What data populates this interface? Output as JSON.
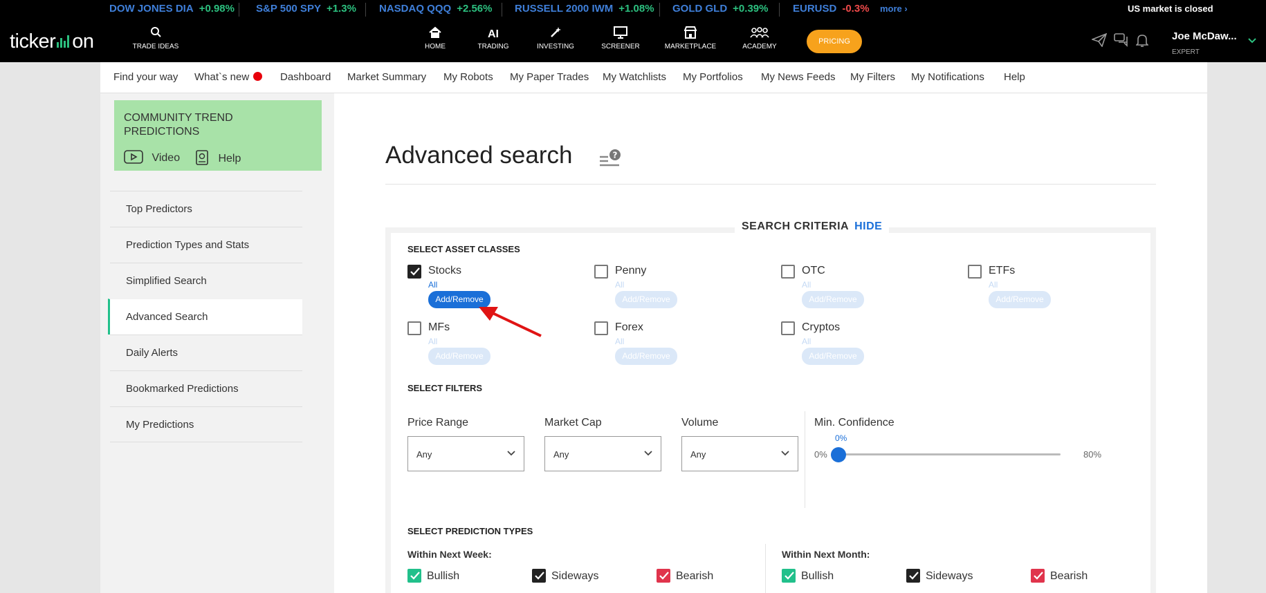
{
  "ticker": {
    "items": [
      {
        "name": "DOW JONES DIA",
        "change": "+0.98%",
        "dir": "pos"
      },
      {
        "name": "S&P 500 SPY",
        "change": "+1.3%",
        "dir": "pos"
      },
      {
        "name": "NASDAQ QQQ",
        "change": "+2.56%",
        "dir": "pos"
      },
      {
        "name": "RUSSELL 2000 IWM",
        "change": "+1.08%",
        "dir": "pos"
      },
      {
        "name": "GOLD GLD",
        "change": "+0.39%",
        "dir": "pos"
      },
      {
        "name": "EURUSD",
        "change": "-0.3%",
        "dir": "neg"
      }
    ],
    "more": "more ›",
    "market_status": "US market is closed"
  },
  "nav": {
    "logo_left": "ticker",
    "logo_right": "on",
    "trade_ideas": "TRADE IDEAS",
    "items": [
      {
        "label": "HOME",
        "icon": "home-icon"
      },
      {
        "label": "TRADING",
        "icon": "ai-text"
      },
      {
        "label": "INVESTING",
        "icon": "wand-icon"
      },
      {
        "label": "SCREENER",
        "icon": "monitor-icon"
      },
      {
        "label": "MARKETPLACE",
        "icon": "store-icon"
      },
      {
        "label": "ACADEMY",
        "icon": "people-icon"
      }
    ],
    "ai_text": "AI",
    "pricing": "PRICING",
    "user_name": "Joe McDaw...",
    "user_role": "EXPERT"
  },
  "subnav": {
    "items": [
      "Find your way",
      "What`s new",
      "Dashboard",
      "Market Summary",
      "My Robots",
      "My Paper Trades",
      "My Watchlists",
      "My Portfolios",
      "My News Feeds",
      "My Filters",
      "My Notifications",
      "Help"
    ]
  },
  "sidebar": {
    "promo_title_1": "COMMUNITY TREND",
    "promo_title_2": "PREDICTIONS",
    "video": "Video",
    "help": "Help",
    "items": [
      "Top Predictors",
      "Prediction Types and Stats",
      "Simplified Search",
      "Advanced Search",
      "Daily Alerts",
      "Bookmarked Predictions",
      "My Predictions"
    ],
    "active_index": 3
  },
  "main": {
    "title": "Advanced search",
    "criteria_title": "SEARCH CRITERIA",
    "criteria_hide": "HIDE",
    "asset_title": "SELECT ASSET CLASSES",
    "assets": [
      {
        "label": "Stocks",
        "checked": true
      },
      {
        "label": "Penny",
        "checked": false
      },
      {
        "label": "OTC",
        "checked": false
      },
      {
        "label": "ETFs",
        "checked": false
      },
      {
        "label": "MFs",
        "checked": false
      },
      {
        "label": "Forex",
        "checked": false
      },
      {
        "label": "Cryptos",
        "checked": false
      }
    ],
    "all_label": "All",
    "add_remove": "Add/Remove",
    "filters_title": "SELECT FILTERS",
    "filters": [
      {
        "label": "Price Range",
        "value": "Any"
      },
      {
        "label": "Market Cap",
        "value": "Any"
      },
      {
        "label": "Volume",
        "value": "Any"
      }
    ],
    "confidence": {
      "label": "Min. Confidence",
      "value": "0%",
      "min": "0%",
      "max": "80%",
      "current_fraction": 0
    },
    "ptypes_title": "SELECT PREDICTION TYPES",
    "week_label": "Within Next Week:",
    "month_label": "Within Next Month:",
    "ptypes": [
      {
        "label": "Bullish",
        "style": "green"
      },
      {
        "label": "Sideways",
        "style": "checked"
      },
      {
        "label": "Bearish",
        "style": "red"
      }
    ]
  },
  "colors": {
    "accent_blue": "#1a6fd8",
    "green": "#21c08b",
    "red": "#e0344c",
    "pricing_orange": "#f7a21c",
    "promo_green": "#a8e2a8"
  }
}
